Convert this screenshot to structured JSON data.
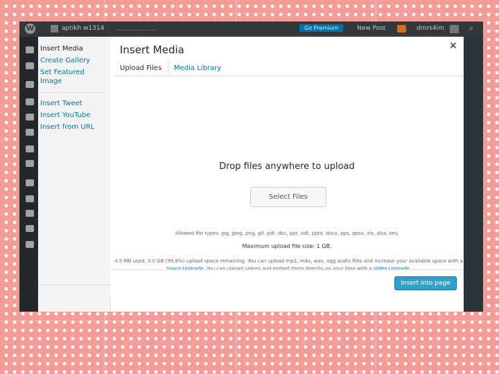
{
  "admin_bar": {
    "site_name": "aptikh w1314",
    "dots": "...............",
    "go_premium": "Go Premium",
    "new_post": "New Post",
    "user": "dmrs4im"
  },
  "side_menu": {
    "items": [
      {
        "label": "Insert Media",
        "active": true
      },
      {
        "label": "Create Gallery"
      },
      {
        "label": "Set Featured Image"
      },
      {
        "label": "Insert Tweet"
      },
      {
        "label": "Insert YouTube"
      },
      {
        "label": "Insert from URL"
      }
    ]
  },
  "modal": {
    "title": "Insert Media",
    "close_glyph": "×",
    "tabs": [
      {
        "label": "Upload Files",
        "active": true
      },
      {
        "label": "Media Library"
      }
    ],
    "drop_text": "Drop files anywhere to upload",
    "select_button": "Select Files",
    "allowed_types": "Allowed file types: jpg, jpeg, png, gif, pdf, doc, ppt, odt, pptx, docx, pps, ppsx, xls, xlsx, key.",
    "max_size": "Maximum upload file size: 1 GB.",
    "space_text_1": "4.5 MB used, 3.0 GB (99.9%) upload space remaining. You can upload mp3, m4a, wav, ogg audio files and increase your available space with a",
    "space_link_1": "Space Upgrade",
    "space_text_2": ". You can upload videos and embed them directly on your blog with a",
    "space_link_2": "Video Upgrade",
    "space_text_3": ".",
    "insert_button": "Insert into page"
  },
  "colors": {
    "background": "#f49c97",
    "admin_bar": "#32373c",
    "link": "#0073aa",
    "primary_button": "#2ea2cc",
    "premium": "#0073aa"
  },
  "icons": {
    "wordpress": "wordpress-logo-icon",
    "close": "close-icon",
    "search": "search-icon"
  }
}
